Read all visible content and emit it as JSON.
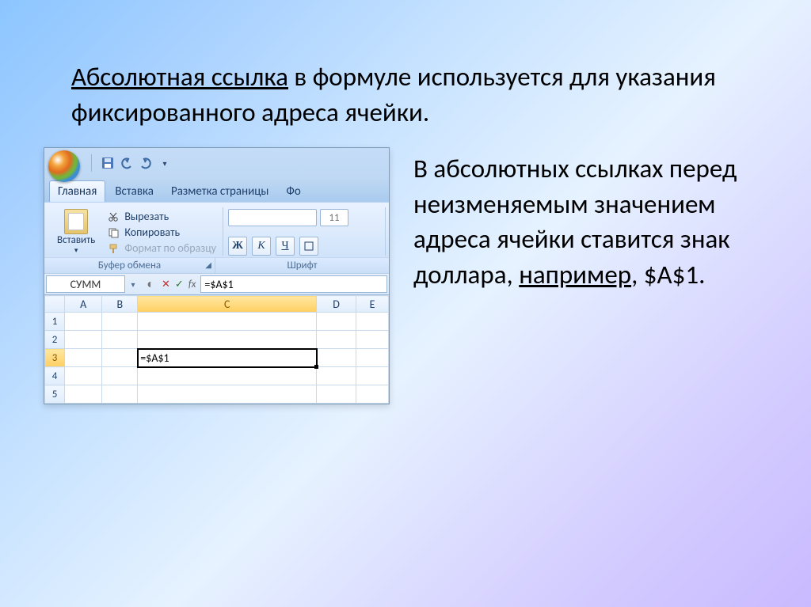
{
  "top_paragraph": {
    "term": "Абсолютная ссылка",
    "rest": " в формуле используется для указания фиксированного адреса ячейки."
  },
  "right_paragraph": {
    "part1": "В абсолютных ссылках перед неизменяемым значением адреса ячейки ставится знак доллара, ",
    "example_word": "например",
    "part2": ", $A$1."
  },
  "excel": {
    "tabs": {
      "home": "Главная",
      "insert": "Вставка",
      "layout": "Разметка страницы",
      "formulas": "Фо"
    },
    "paste_label": "Вставить",
    "cut": "Вырезать",
    "copy": "Копировать",
    "format_painter": "Формат по образцу",
    "group_clipboard": "Буфер обмена",
    "group_font": "Шрифт",
    "font_size": "11",
    "bold": "Ж",
    "italic": "К",
    "underline": "Ч",
    "name_box": "СУММ",
    "fx": "fx",
    "cancel": "✕",
    "enter": "✓",
    "formula": "=$A$1",
    "columns": [
      "A",
      "B",
      "C",
      "D",
      "E"
    ],
    "rows": [
      "1",
      "2",
      "3",
      "4",
      "5"
    ],
    "cell_value": "=$A$1"
  }
}
